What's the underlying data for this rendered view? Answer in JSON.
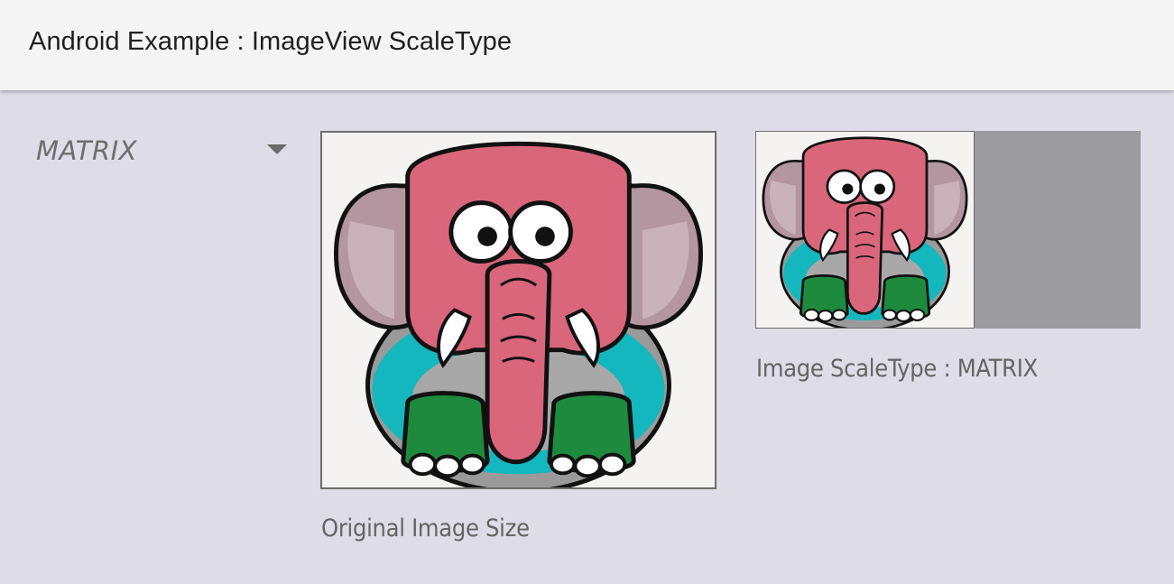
{
  "app": {
    "title": "Android Example : ImageView ScaleType"
  },
  "spinner": {
    "selected": "MATRIX"
  },
  "images": {
    "original_caption": "Original Image Size",
    "matrix_caption": "Image ScaleType : MATRIX",
    "subject": "elephant-illustration"
  },
  "colors": {
    "toolbar_bg": "#f4f4f4",
    "content_bg": "#dedce6",
    "image_view_bg": "#9c9ba0",
    "elephant_head": "#d9667b",
    "elephant_ear": "#b3969f",
    "elephant_body": "#14b7bd",
    "elephant_legs": "#1e8a3e"
  }
}
